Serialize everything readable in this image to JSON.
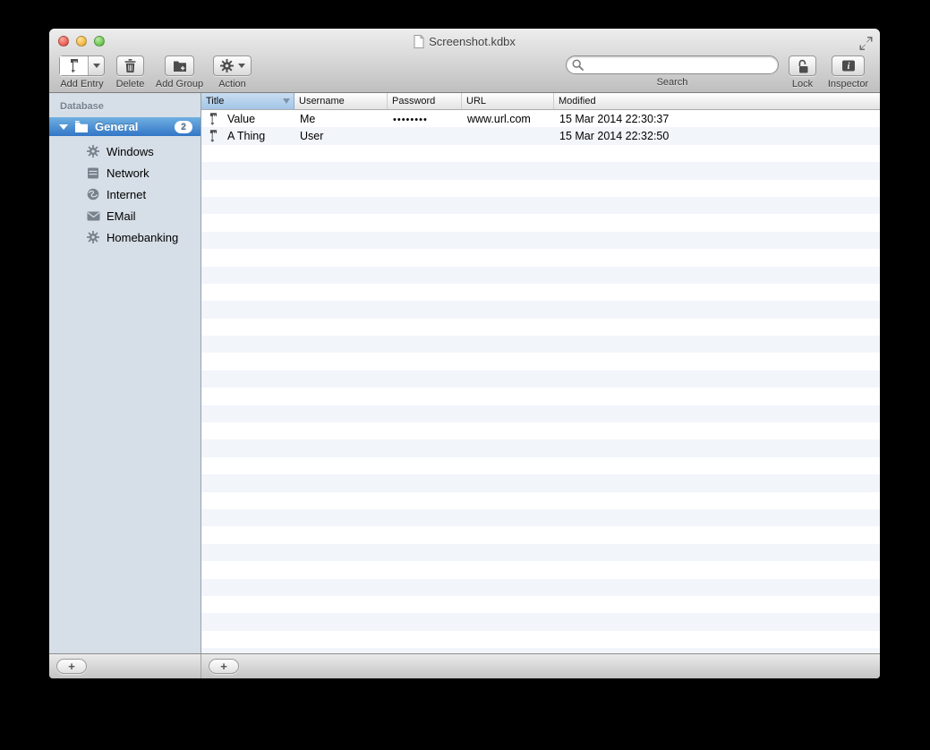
{
  "window": {
    "title": "Screenshot.kdbx"
  },
  "toolbar": {
    "add_entry_label": "Add Entry",
    "delete_label": "Delete",
    "add_group_label": "Add Group",
    "action_label": "Action",
    "search_label": "Search",
    "search_value": "",
    "lock_label": "Lock",
    "inspector_label": "Inspector"
  },
  "sidebar": {
    "section_label": "Database",
    "selected_group": {
      "label": "General",
      "badge": "2"
    },
    "items": [
      {
        "label": "Windows",
        "icon": "gear-icon"
      },
      {
        "label": "Network",
        "icon": "server-icon"
      },
      {
        "label": "Internet",
        "icon": "globe-icon"
      },
      {
        "label": "EMail",
        "icon": "envelope-icon"
      },
      {
        "label": "Homebanking",
        "icon": "gear-icon"
      }
    ],
    "add_button_label": "+"
  },
  "table": {
    "columns": [
      "Title",
      "Username",
      "Password",
      "URL",
      "Modified"
    ],
    "sorted_column": "Title",
    "sort_direction": "descending",
    "rows": [
      {
        "title": "Value",
        "username": "Me",
        "password": "••••••••",
        "url": "www.url.com",
        "modified": "15 Mar 2014 22:30:37"
      },
      {
        "title": "A Thing",
        "username": "User",
        "password": "",
        "url": "",
        "modified": "15 Mar 2014 22:32:50"
      }
    ],
    "visible_row_slots": 32,
    "add_button_label": "+"
  },
  "colors": {
    "selection_blue_top": "#6fb0e2",
    "selection_blue_bottom": "#3376c6",
    "sidebar_background": "#d6dee7",
    "row_stripe": "#f2f5fa",
    "sorted_header_top": "#c9ddf1",
    "sorted_header_bottom": "#a2c5e7",
    "traffic_red": "#ed6a5e",
    "traffic_yellow": "#f5bf4f",
    "traffic_green": "#78cf5d"
  }
}
